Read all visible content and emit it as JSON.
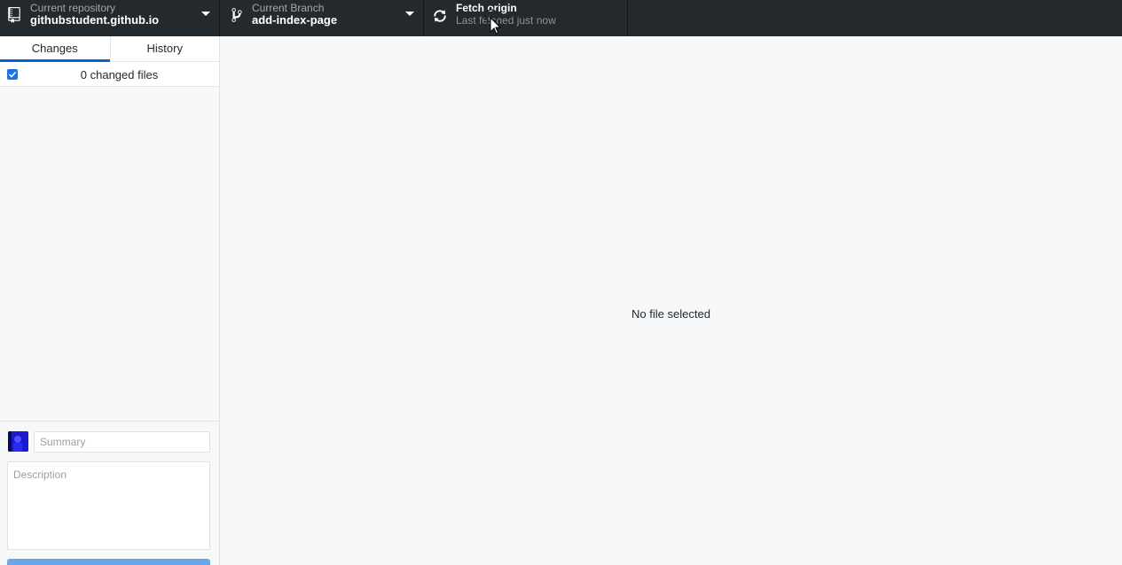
{
  "toolbar": {
    "repository": {
      "label": "Current repository",
      "value": "githubstudent.github.io",
      "icon": "repo-icon"
    },
    "branch": {
      "label": "Current Branch",
      "value": "add-index-page",
      "icon": "git-branch-icon"
    },
    "fetch": {
      "label": "Fetch origin",
      "value": "Last fetched just now",
      "icon": "sync-icon"
    }
  },
  "sidebar": {
    "tabs": [
      {
        "label": "Changes",
        "active": true
      },
      {
        "label": "History",
        "active": false
      }
    ],
    "changes": {
      "count_label": "0 changed files",
      "all_selected": true
    },
    "commit": {
      "summary_placeholder": "Summary",
      "description_placeholder": "Description"
    }
  },
  "main": {
    "empty_message": "No file selected"
  },
  "colors": {
    "toolbar_bg": "#24292e",
    "accent": "#0366d6",
    "commit_button": "#6ca6ea"
  }
}
